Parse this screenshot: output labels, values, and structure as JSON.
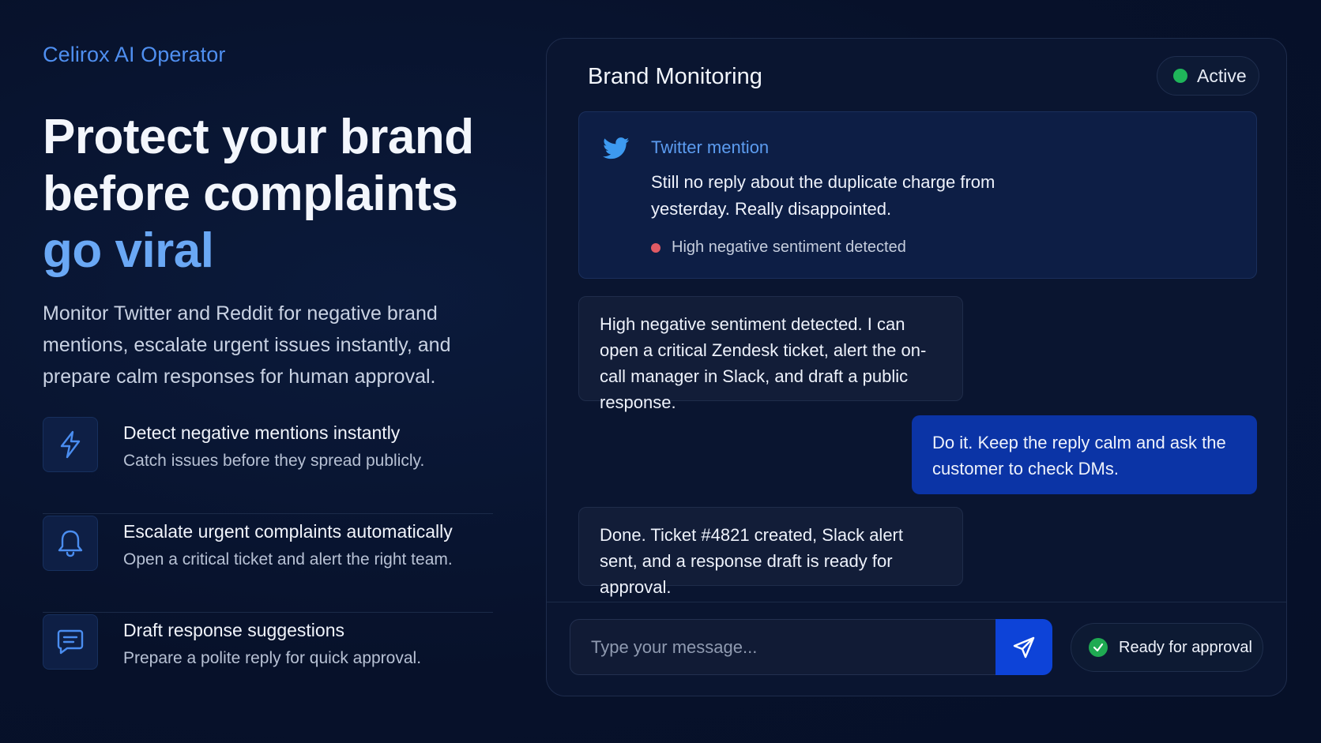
{
  "left": {
    "brand": "Celirox AI Operator",
    "headline": {
      "line1": "Protect your brand",
      "line2": "before complaints",
      "accent": "go viral"
    },
    "subtitle": "Monitor Twitter and Reddit for negative brand mentions, escalate urgent issues instantly, and prepare calm responses for human approval.",
    "features": [
      {
        "title": "Detect negative mentions instantly",
        "desc": "Catch issues before they spread publicly.",
        "icon": "lightning-icon"
      },
      {
        "title": "Escalate urgent complaints automatically",
        "desc": "Open a critical ticket and alert the right team.",
        "icon": "bell-icon"
      },
      {
        "title": "Draft response suggestions",
        "desc": "Prepare a polite reply for quick approval.",
        "icon": "chat-icon"
      }
    ]
  },
  "panel": {
    "title": "Brand Monitoring",
    "status": {
      "label": "Active",
      "color": "#1fb55a"
    },
    "mention": {
      "source": "Twitter mention",
      "icon": "twitter-icon",
      "text": "Still no reply about the duplicate charge from yesterday. Really disappointed.",
      "sentiment": "High negative sentiment detected",
      "sentiment_color": "#e05a64"
    },
    "messages": [
      {
        "role": "ai",
        "text": "High negative sentiment detected. I can open a critical Zendesk ticket, alert the on-call manager in Slack, and draft a public response."
      },
      {
        "role": "user",
        "text": "Do it. Keep the reply calm and ask the customer to check DMs."
      },
      {
        "role": "ai",
        "text": "Done. Ticket #4821 created, Slack alert sent, and a response draft is ready for approval."
      }
    ],
    "composer": {
      "placeholder": "Type your message...",
      "send_icon": "send-icon"
    },
    "approval": {
      "label": "Ready for approval",
      "icon": "check-icon"
    }
  },
  "colors": {
    "background": "#07112a",
    "accent": "#4f8ff0",
    "user_bubble": "#0b34a6",
    "send_button": "#0d43d8"
  }
}
